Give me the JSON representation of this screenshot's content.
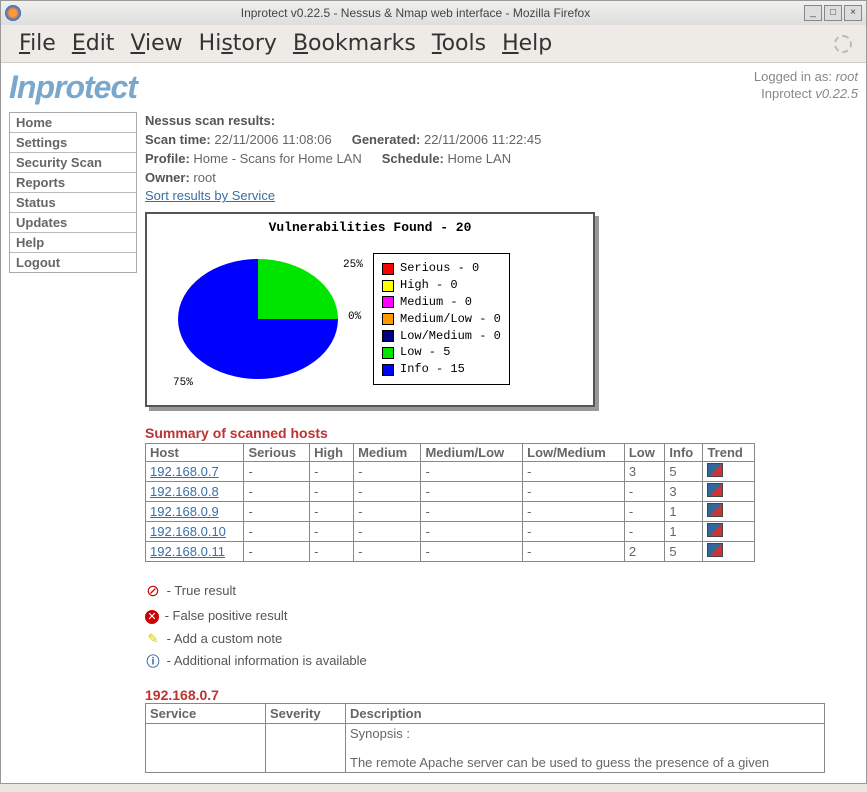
{
  "window": {
    "title": "Inprotect v0.22.5 - Nessus & Nmap web interface - Mozilla Firefox"
  },
  "menubar": [
    "File",
    "Edit",
    "View",
    "History",
    "Bookmarks",
    "Tools",
    "Help"
  ],
  "logo": "Inprotect",
  "login": {
    "prefix": "Logged in as: ",
    "user": "root",
    "app": "Inprotect ",
    "ver": "v0.22.5"
  },
  "sidebar": [
    "Home",
    "Settings",
    "Security Scan",
    "Reports",
    "Status",
    "Updates",
    "Help",
    "Logout"
  ],
  "results": {
    "heading": "Nessus scan results:",
    "scan_time_label": "Scan time: ",
    "scan_time": "22/11/2006 11:08:06",
    "generated_label": "Generated: ",
    "generated": "22/11/2006 11:22:45",
    "profile_label": "Profile: ",
    "profile": "Home - Scans for Home LAN",
    "schedule_label": "Schedule: ",
    "schedule": "Home LAN",
    "owner_label": "Owner: ",
    "owner": "root",
    "sort_link": "Sort results by Service"
  },
  "chart_data": {
    "type": "pie",
    "title": "Vulnerabilities Found - 20",
    "series": [
      {
        "name": "Serious",
        "value": 0,
        "color": "#ff0000"
      },
      {
        "name": "High",
        "value": 0,
        "color": "#ffff00"
      },
      {
        "name": "Medium",
        "value": 0,
        "color": "#ff00ff"
      },
      {
        "name": "Medium/Low",
        "value": 0,
        "color": "#ff9900"
      },
      {
        "name": "Low/Medium",
        "value": 0,
        "color": "#000080"
      },
      {
        "name": "Low",
        "value": 5,
        "color": "#00e500"
      },
      {
        "name": "Info",
        "value": 15,
        "color": "#0000ff"
      }
    ],
    "labels": {
      "low_pct": "25%",
      "zero_pct": "0%",
      "info_pct": "75%"
    }
  },
  "summary": {
    "title": "Summary of scanned hosts",
    "columns": [
      "Host",
      "Serious",
      "High",
      "Medium",
      "Medium/Low",
      "Low/Medium",
      "Low",
      "Info",
      "Trend"
    ],
    "rows": [
      {
        "host": "192.168.0.7",
        "serious": "-",
        "high": "-",
        "medium": "-",
        "medlow": "-",
        "lowmed": "-",
        "low": "3",
        "info": "5"
      },
      {
        "host": "192.168.0.8",
        "serious": "-",
        "high": "-",
        "medium": "-",
        "medlow": "-",
        "lowmed": "-",
        "low": "-",
        "info": "3"
      },
      {
        "host": "192.168.0.9",
        "serious": "-",
        "high": "-",
        "medium": "-",
        "medlow": "-",
        "lowmed": "-",
        "low": "-",
        "info": "1"
      },
      {
        "host": "192.168.0.10",
        "serious": "-",
        "high": "-",
        "medium": "-",
        "medlow": "-",
        "lowmed": "-",
        "low": "-",
        "info": "1"
      },
      {
        "host": "192.168.0.11",
        "serious": "-",
        "high": "-",
        "medium": "-",
        "medlow": "-",
        "lowmed": "-",
        "low": "2",
        "info": "5"
      }
    ]
  },
  "legend_icons": {
    "true_result": " - True result",
    "false_positive": " - False positive result",
    "custom_note": " - Add a custom note",
    "additional": " - Additional information is available"
  },
  "detail": {
    "host": "192.168.0.7",
    "columns": [
      "Service",
      "Severity",
      "Description"
    ],
    "desc_line1": "Synopsis :",
    "desc_line2": "The remote Apache server can be used to guess the presence of a given"
  }
}
